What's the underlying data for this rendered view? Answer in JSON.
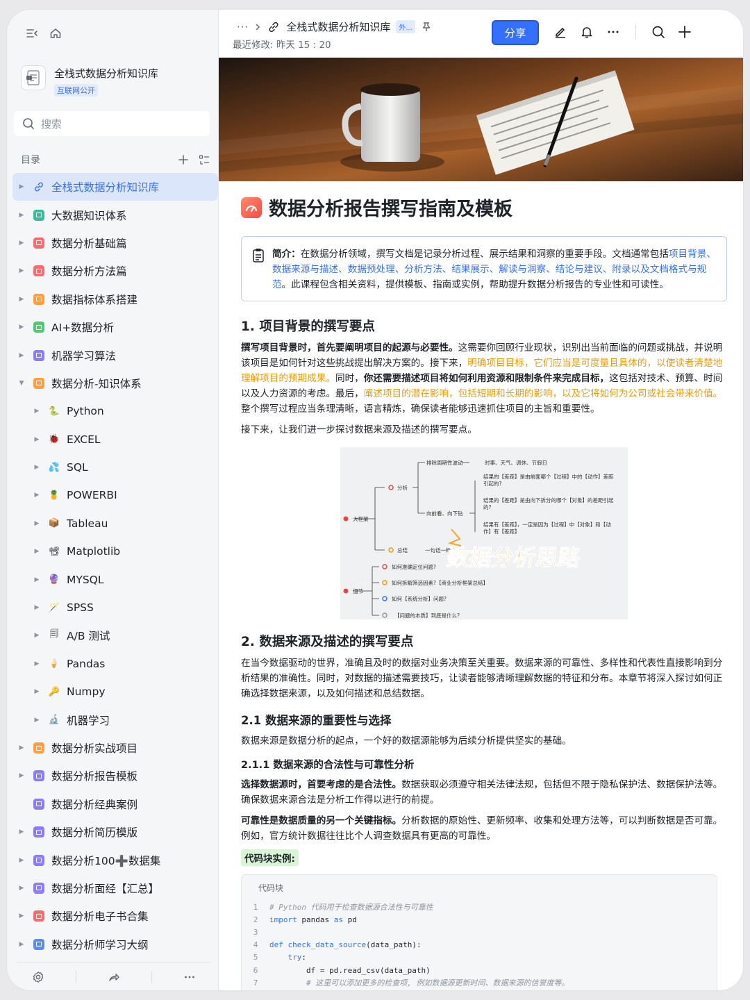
{
  "sidebar": {
    "workspace_title": "全栈式数据分析知识库",
    "workspace_badge": "互联网公开",
    "search_placeholder": "搜索",
    "toc_label": "目录",
    "items": [
      {
        "label": "全栈式数据分析知识库",
        "level": 0,
        "icon": "link-icon",
        "active": true,
        "expanded": false
      },
      {
        "label": "大数据知识体系",
        "level": 0,
        "icon": "sparkle-icon",
        "color": "#35bd9e"
      },
      {
        "label": "数据分析基础篇",
        "level": 0,
        "icon": "board-icon",
        "color": "#f76d6d"
      },
      {
        "label": "数据分析方法篇",
        "level": 0,
        "icon": "board-icon",
        "color": "#f76d6d"
      },
      {
        "label": "数据指标体系搭建",
        "level": 0,
        "icon": "chart-icon",
        "color": "#ff9f3e"
      },
      {
        "label": "AI+数据分析",
        "level": 0,
        "icon": "home-icon",
        "color": "#4ecb71"
      },
      {
        "label": "机器学习算法",
        "level": 0,
        "icon": "board-icon",
        "color": "#8d7cf3"
      },
      {
        "label": "数据分析-知识体系",
        "level": 0,
        "icon": "board-icon",
        "color": "#ff9f3e",
        "expanded": true
      },
      {
        "label": "Python",
        "level": 1,
        "icon": "snake-icon",
        "emoji": "🐍"
      },
      {
        "label": "EXCEL",
        "level": 1,
        "icon": "ladybug-icon",
        "emoji": "🐞"
      },
      {
        "label": "SQL",
        "level": 1,
        "icon": "droplets-icon",
        "emoji": "💦"
      },
      {
        "label": "POWERBI",
        "level": 1,
        "icon": "pineapple-icon",
        "emoji": "🍍"
      },
      {
        "label": "Tableau",
        "level": 1,
        "icon": "package-icon",
        "emoji": "📦"
      },
      {
        "label": "Matplotlib",
        "level": 1,
        "icon": "film-projector-icon",
        "emoji": "📽"
      },
      {
        "label": "MYSQL",
        "level": 1,
        "icon": "crystal-ball-icon",
        "emoji": "🔮"
      },
      {
        "label": "SPSS",
        "level": 1,
        "icon": "magic-wand-icon",
        "emoji": "🪄"
      },
      {
        "label": "A/B 测试",
        "level": 1,
        "icon": "doc-copy-icon",
        "emoji": "🗐"
      },
      {
        "label": "Pandas",
        "level": 1,
        "icon": "ice-cream-icon",
        "emoji": "🍦"
      },
      {
        "label": "Numpy",
        "level": 1,
        "icon": "key-icon",
        "emoji": "🔑"
      },
      {
        "label": "机器学习",
        "level": 1,
        "icon": "microscope-icon",
        "emoji": "🔬"
      },
      {
        "label": "数据分析实战项目",
        "level": 0,
        "icon": "board-icon",
        "color": "#ff9f3e"
      },
      {
        "label": "数据分析报告模板",
        "level": 0,
        "icon": "board-icon",
        "color": "#8d7cf3"
      },
      {
        "label": "数据分析经典案例",
        "level": 0,
        "icon": "board-icon",
        "color": "#8d7cf3",
        "no_arrow": true
      },
      {
        "label": "数据分析简历模版",
        "level": 0,
        "icon": "list-icon",
        "color": "#8d7cf3"
      },
      {
        "label": "数据分析100➕数据集",
        "level": 0,
        "icon": "list-icon",
        "color": "#8d7cf3"
      },
      {
        "label": "数据分析面经【汇总】",
        "level": 0,
        "icon": "list-icon",
        "color": "#8d7cf3"
      },
      {
        "label": "数据分析电子书合集",
        "level": 0,
        "icon": "list-icon",
        "color": "#f76d6d"
      },
      {
        "label": "数据分析师学习大纲",
        "level": 0,
        "icon": "clock-icon",
        "color": "#5b8def"
      }
    ]
  },
  "header": {
    "breadcrumb_dots": "···",
    "doc_name": "全栈式数据分析知识库",
    "external_badge": "外...",
    "last_modified": "最近修改: 昨天 15 : 20",
    "share_label": "分享"
  },
  "doc": {
    "title": "数据分析报告撰写指南及模板",
    "callout": {
      "lead": "简介：",
      "text1": "在数据分析领域，撰写文档是记录分析过程、展示结果和洞察的重要手段。文档通常包括",
      "links": "项目背景、数据来源与描述、数据预处理、分析方法、结果展示、解读与洞察、结论与建议、附录以及文档格式与规范",
      "text2": "。此课程包含相关资料，提供模板、指南或实例，帮助提升数据分析报告的专业性和可读性。"
    },
    "s1": {
      "heading": "1. 项目背景的撰写要点",
      "p1_b1": "撰写项目背景时，首先要阐明项目的起源与必要性。",
      "p1_t1": "这需要你回顾行业现状，识别出当前面临的问题或挑战，并说明该项目是如何针对这些挑战提出解决方案的。接下来，",
      "p1_o1": "明确项目目标，它们应当是可度量且具体的，以使读者清楚地理解项目的预期成果。",
      "p1_t2": "同时，",
      "p1_b2": "你还需要描述项目将如何利用资源和限制条件来完成目标，",
      "p1_t3": "这包括对技术、预算、时间以及人力资源的考虑。最后，",
      "p1_o2": "阐述项目的潜在影响，包括短期和长期的影响，以及它将如何为公司或社会带来价值。",
      "p1_t4": "整个撰写过程应当条理清晰，语言精炼，确保读者能够迅速抓住项目的主旨和重要性。",
      "p2": "接下来，让我们进一步探讨数据来源及描述的撰写要点。"
    },
    "mindmap": {
      "big_frame": "大框架",
      "analysis": "分析",
      "summary": "总结",
      "details": "细节",
      "exclude": "排除周期性波动",
      "exclude_items": "时事、天气、调休、节假日",
      "look_forward": "向前看、向下钻",
      "q1": "结果的【差距】是由前面哪个【过程】中的【动作】差距引起的?",
      "q2": "结果的【差距】是由向下拆分的哪个【对象】的差距引起的?",
      "q3": "结果有【差距】，一定是因为【过程】中【对象】和【动作】有【差距】",
      "summary_line": "一句话一幅图",
      "d1": "如何准确定位问题?",
      "d2": "如何拆解筛选因素?【商业分析框架总结】",
      "d3": "如何【系统分析】问题?",
      "d4": "【问题的本质】到底是什么?",
      "watermark": "数据分析思路"
    },
    "s2": {
      "heading": "2. 数据来源及描述的撰写要点",
      "p1": "在当今数据驱动的世界，准确且及时的数据对业务决策至关重要。数据来源的可靠性、多样性和代表性直接影响到分析结果的准确性。同时，对数据的描述需要技巧，让读者能够清晰理解数据的特征和分布。本章节将深入探讨如何正确选择数据来源，以及如何描述和总结数据。",
      "h21": "2.1 数据来源的重要性与选择",
      "red_line": "数据来源是数据分析的起点，一个好的数据源能够为后续分析提供坚实的基础。",
      "h211": "2.1.1 数据来源的合法性与可靠性分析",
      "p2_b": "选择数据源时，首要考虑的是合法性。",
      "p2_t": "数据获取必须遵守相关法律法规，包括但不限于隐私保护法、数据保护法等。确保数据来源合法是分析工作得以进行的前提。",
      "p3_b": "可靠性是数据质量的另一个关键指标。",
      "p3_t": "分析数据的原始性、更新频率、收集和处理方法等，可以判断数据是否可靠。例如，官方统计数据往往比个人调查数据具有更高的可靠性。",
      "tag": "代码块实例:"
    },
    "code": {
      "title": "代码块",
      "lines": [
        {
          "n": "1",
          "comment": "# Python 代码用于检查数据源合法性与可靠性"
        },
        {
          "n": "2",
          "kw": "import",
          "text": " pandas ",
          "kw2": "as",
          "text2": " pd"
        },
        {
          "n": "3"
        },
        {
          "n": "4",
          "kw": "def",
          "fn": " check_data_source",
          "text": "(data_path):"
        },
        {
          "n": "5",
          "indent": "    ",
          "kw": "try",
          "text": ":"
        },
        {
          "n": "6",
          "indent": "        ",
          "text": "df = pd.read_csv(data_path)"
        },
        {
          "n": "7",
          "indent": "        ",
          "comment": "# 这里可以添加更多的检查项, 例如数据源更新时间、数据来源的信誉度等。"
        }
      ]
    }
  },
  "colors": {
    "accent": "#3370ff",
    "red": "#f54a45",
    "orange": "#ed9b0a",
    "sidebar_bg": "#f5f6f7"
  }
}
